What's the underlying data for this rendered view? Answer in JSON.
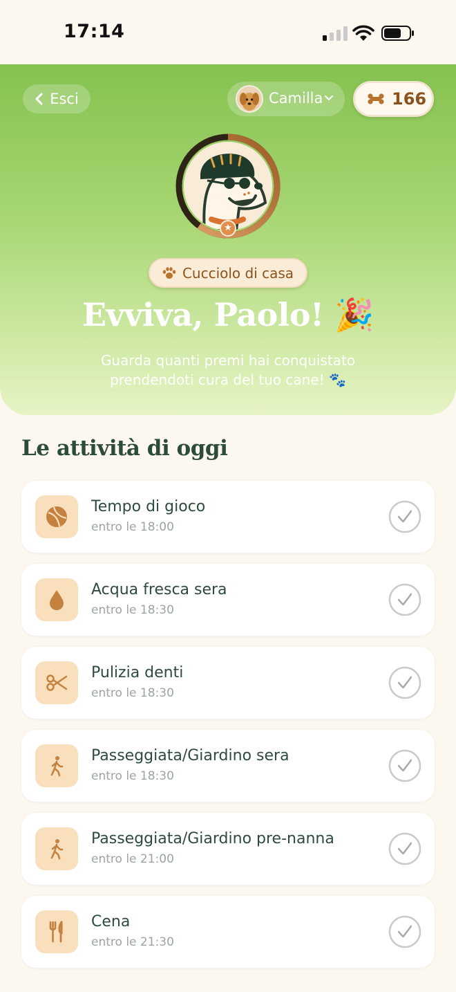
{
  "status_bar": {
    "time": "17:14"
  },
  "header": {
    "back_label": "Esci",
    "profile_name": "Camilla",
    "bones_count": "166"
  },
  "hero": {
    "badge_label": "Cucciolo di casa",
    "headline": "Evviva, Paolo! 🎉",
    "subtitle_line1": "Guarda quanti premi hai conquistato",
    "subtitle_line2": "prendendoti cura del tuo cane! 🐾",
    "level_progress": 0.6
  },
  "section": {
    "title": "Le attività di oggi"
  },
  "tasks": [
    {
      "title": "Tempo di gioco",
      "due": "entro le 18:00",
      "icon": "ball-icon"
    },
    {
      "title": "Acqua fresca sera",
      "due": "entro le 18:30",
      "icon": "water-drop-icon"
    },
    {
      "title": "Pulizia denti",
      "due": "entro le 18:30",
      "icon": "scissors-icon"
    },
    {
      "title": "Passeggiata/Giardino sera",
      "due": "entro le 18:30",
      "icon": "walking-icon"
    },
    {
      "title": "Passeggiata/Giardino pre-nanna",
      "due": "entro le 21:00",
      "icon": "walking-icon"
    },
    {
      "title": "Cena",
      "due": "entro le 21:30",
      "icon": "fork-knife-icon"
    }
  ],
  "colors": {
    "hero_top": "#84c24f",
    "hero_bottom": "#e6f4c4",
    "text_dark_green": "#2d4b3a",
    "accent_brown": "#8a531e",
    "icon_tile": "#f9dfbb",
    "icon_fill": "#c48240"
  }
}
